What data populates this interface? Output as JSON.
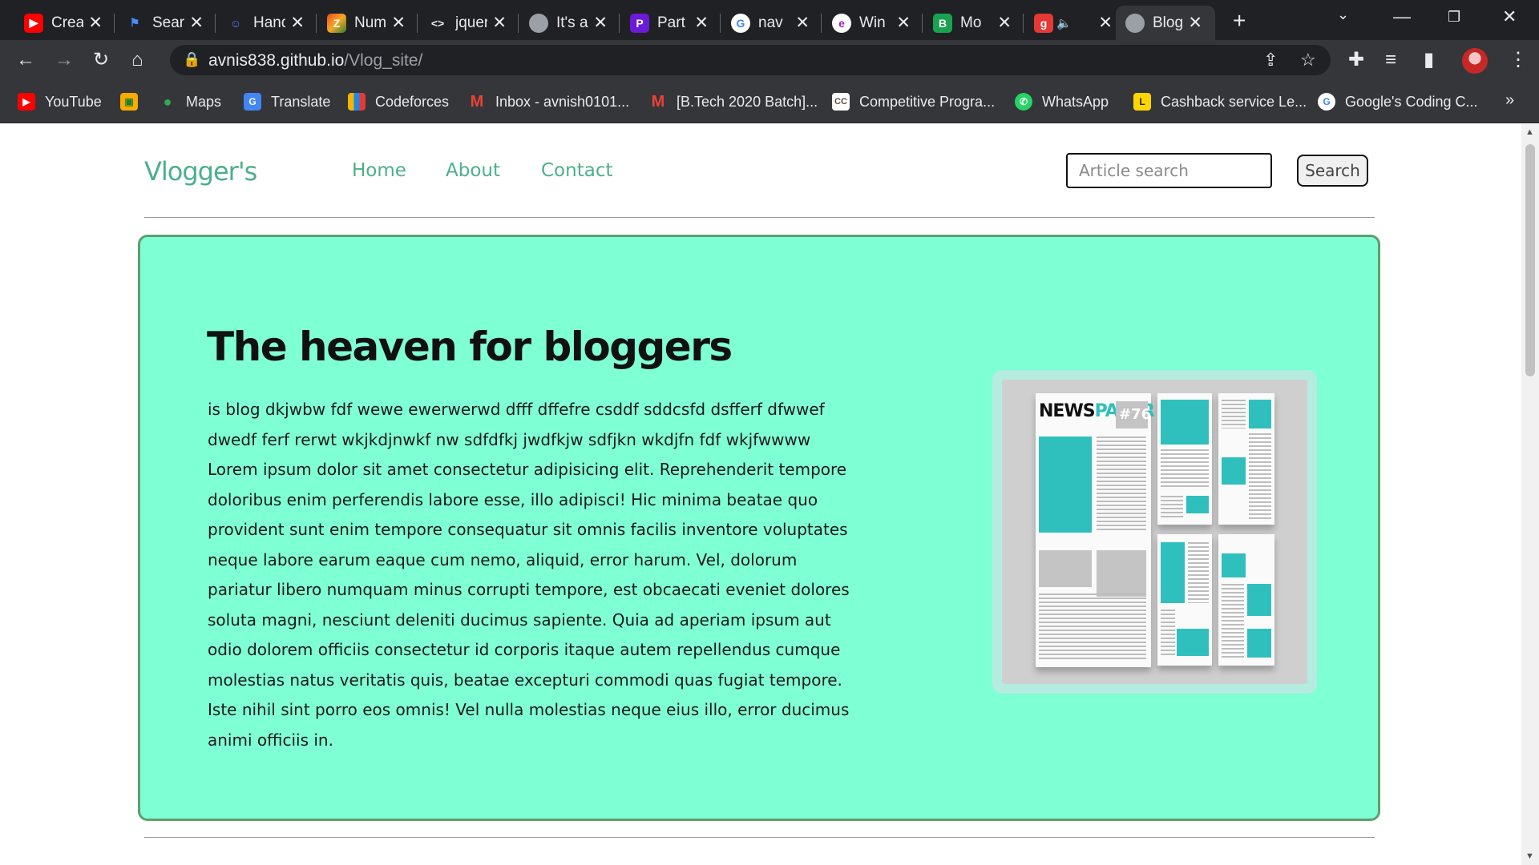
{
  "browser": {
    "tabs": [
      {
        "title": "Create",
        "favicon": "youtube-icon",
        "color": "#ff0000"
      },
      {
        "title": "Search",
        "favicon": "flag-icon",
        "color": "#4a8df8"
      },
      {
        "title": "Hand",
        "favicon": "robot-icon",
        "color": "#5b7cf0"
      },
      {
        "title": "Number",
        "favicon": "multicolor-z-icon",
        "color": "#e84e1b"
      },
      {
        "title": "jquery",
        "favicon": "code-icon",
        "color": "#e8eaed"
      },
      {
        "title": "It's a",
        "favicon": "globe-icon",
        "color": "#9aa0a6"
      },
      {
        "title": "Part",
        "favicon": "purple-p-icon",
        "color": "#6a1bd6"
      },
      {
        "title": "nav",
        "favicon": "google-icon",
        "color": "#4285f4"
      },
      {
        "title": "Win",
        "favicon": "edge-e-icon",
        "color": "#9c27b0"
      },
      {
        "title": "Mo",
        "favicon": "green-app-icon",
        "color": "#1aa251"
      },
      {
        "title": "",
        "favicon": "red-g-icon",
        "color": "#e53935"
      },
      {
        "title": "Blog",
        "favicon": "globe-icon",
        "color": "#9aa0a6"
      }
    ],
    "url_host": "avnis838.github.io",
    "url_path": "/Vlog_site/",
    "bookmarks": [
      {
        "label": "YouTube",
        "favicon": "youtube-icon",
        "color": "#ff0000"
      },
      {
        "label": "",
        "favicon": "classroom-icon",
        "color": "#f9ab00"
      },
      {
        "label": "Maps",
        "favicon": "maps-pin-icon",
        "color": "#34a853"
      },
      {
        "label": "Translate",
        "favicon": "translate-icon",
        "color": "#4285f4"
      },
      {
        "label": "Codeforces",
        "favicon": "codeforces-icon",
        "color": "#f4b400"
      },
      {
        "label": "Inbox - avnish0101...",
        "favicon": "gmail-icon",
        "color": "#ea4335"
      },
      {
        "label": "[B.Tech 2020 Batch]...",
        "favicon": "gmail-icon",
        "color": "#ea4335"
      },
      {
        "label": "Competitive Progra...",
        "favicon": "cc-icon",
        "color": "#5f4b3a"
      },
      {
        "label": "WhatsApp",
        "favicon": "whatsapp-icon",
        "color": "#25d366"
      },
      {
        "label": "Cashback service Le...",
        "favicon": "cashback-icon",
        "color": "#ffd600"
      },
      {
        "label": "Google's Coding C...",
        "favicon": "google-icon",
        "color": "#4285f4"
      }
    ]
  },
  "site": {
    "brand": "Vlogger's",
    "nav": [
      "Home",
      "About",
      "Contact"
    ],
    "search_placeholder": "Article search",
    "search_button": "Search",
    "hero_title": "The heaven for bloggers",
    "hero_text": "is blog dkjwbw fdf wewe ewerwerwd dfff dffefre csddf sddcsfd dsfferf dfwwef dwedf ferf rerwt wkjkdjnwkf nw sdfdfkj jwdfkjw sdfjkn wkdjfn fdf wkjfwwww Lorem ipsum dolor sit amet consectetur adipisicing elit. Reprehenderit tempore doloribus enim perferendis labore esse, illo adipisci! Hic minima beatae quo provident sunt enim tempore consequatur sit omnis facilis inventore voluptates neque labore earum eaque cum nemo, aliquid, error harum. Vel, dolorum pariatur libero numquam minus corrupti tempore, est obcaecati eveniet dolores soluta magni, nesciunt deleniti ducimus sapiente. Quia ad aperiam ipsum aut odio dolorem officiis consectetur id corporis itaque autem repellendus cumque molestias natus veritatis quis, beatae excepturi commodi quas fugiat tempore. Iste nihil sint porro eos omnis! Vel nulla molestias neque eius illo, error ducimus animi officiis in.",
    "image": {
      "headline_a": "NEWS",
      "headline_b": "PAPER",
      "issue": "#76"
    }
  },
  "colors": {
    "accent": "#4caf8a",
    "hero_bg": "#7fffd4",
    "hero_border": "#5f9f6f",
    "news_teal": "#2fc0bd"
  }
}
